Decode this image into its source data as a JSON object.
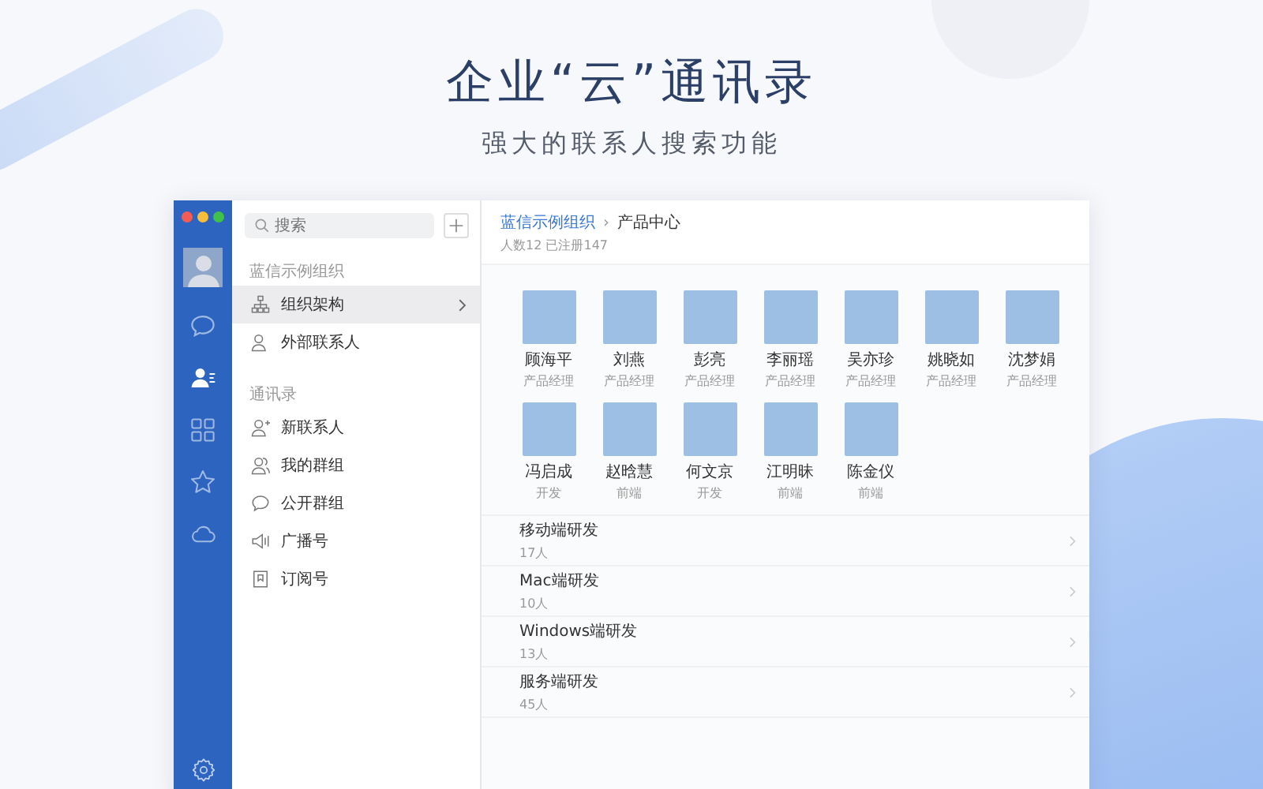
{
  "headline": "企业“云”通讯录",
  "subheadline": "强大的联系人搜索功能",
  "rail": {
    "items": [
      {
        "kind": "chat",
        "selected": false
      },
      {
        "kind": "contacts",
        "selected": true
      },
      {
        "kind": "apps",
        "selected": false
      },
      {
        "kind": "star",
        "selected": false
      },
      {
        "kind": "cloud",
        "selected": false
      }
    ]
  },
  "sidebar": {
    "search": {
      "placeholder": "搜索"
    },
    "sections": [
      {
        "title": "蓝信示例组织",
        "items": [
          {
            "kind": "org",
            "label": "组织架构",
            "selected": true
          },
          {
            "kind": "external",
            "label": "外部联系人",
            "selected": false
          }
        ]
      },
      {
        "title": "通讯录",
        "items": [
          {
            "kind": "new-contact",
            "label": "新联系人",
            "selected": false
          },
          {
            "kind": "groups",
            "label": "我的群组",
            "selected": false
          },
          {
            "kind": "public-group",
            "label": "公开群组",
            "selected": false
          },
          {
            "kind": "broadcast",
            "label": "广播号",
            "selected": false
          },
          {
            "kind": "subscription",
            "label": "订阅号",
            "selected": false
          }
        ]
      }
    ]
  },
  "main": {
    "breadcrumb": {
      "parent": "蓝信示例组织",
      "separator": "›",
      "current": "产品中心"
    },
    "stats": "人数12 已注册147",
    "people": [
      {
        "name": "顾海平",
        "role": "产品经理"
      },
      {
        "name": "刘燕",
        "role": "产品经理"
      },
      {
        "name": "彭亮",
        "role": "产品经理"
      },
      {
        "name": "李丽瑶",
        "role": "产品经理"
      },
      {
        "name": "吴亦珍",
        "role": "产品经理"
      },
      {
        "name": "姚晓如",
        "role": "产品经理"
      },
      {
        "name": "沈梦娟",
        "role": "产品经理"
      },
      {
        "name": "冯启成",
        "role": "开发"
      },
      {
        "name": "赵晗慧",
        "role": "前端"
      },
      {
        "name": "何文京",
        "role": "开发"
      },
      {
        "name": "江明昧",
        "role": "前端"
      },
      {
        "name": "陈金仪",
        "role": "前端"
      }
    ],
    "groups": [
      {
        "name": "移动端研发",
        "count": "17人"
      },
      {
        "name": "Mac端研发",
        "count": "10人"
      },
      {
        "name": "Windows端研发",
        "count": "13人"
      },
      {
        "name": "服务端研发",
        "count": "45人"
      }
    ]
  }
}
